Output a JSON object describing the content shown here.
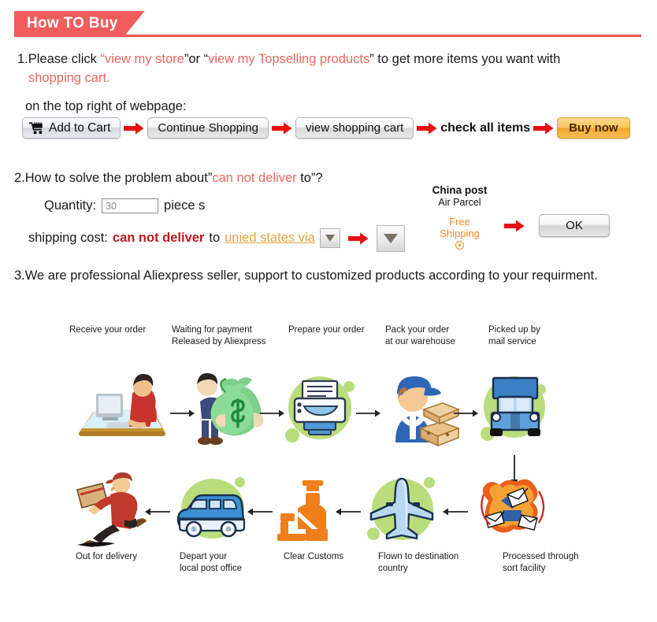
{
  "header": {
    "title": "How TO Buy",
    "accent_color": "#f25c5c"
  },
  "section1": {
    "number": "1.",
    "line1_a": "Please click ",
    "line1_quote_open": "“",
    "link1": "view my store",
    "line1_quote_close": "”",
    "line1_b": "or ",
    "quote2_open": "“",
    "link2": "view my Topselling products",
    "quote2_close": "”",
    "line1_c": " to get more items you want with",
    "line2": "shopping cart.",
    "line3": "on the top right of webpage:"
  },
  "buttons": {
    "add_to_cart": "Add to Cart",
    "cart_icon": "shopping-cart-icon",
    "continue_shopping": "Continue Shopping",
    "view_shopping_cart": "view shopping cart",
    "check_all_items": "check all items",
    "buy_now": "Buy now",
    "buy_now_color": "#f0a82e"
  },
  "section2": {
    "number": "2.",
    "line1_a": "How to solve the problem about”",
    "line1_red": "can not deliver",
    "line1_b": " to”?",
    "quantity_label": "Quantity:",
    "quantity_value": "30",
    "piece_label": "piece s",
    "shipping_label": "shipping cost:",
    "shipping_red": "can not deliver",
    "shipping_to": " to ",
    "shipping_country": "unied states via",
    "dropdown_icon": "chevron-down-icon"
  },
  "china_post": {
    "title": "China post",
    "subtitle": "Air Parcel",
    "free_line1": "Free",
    "free_line2": "Shipping",
    "radio_icon": "radio-selected-icon",
    "free_color": "#f08a22",
    "ok_button": "OK"
  },
  "section3": {
    "text": "3.We are professional Aliexpress seller, support to customized products according to your requirment."
  },
  "flowchart": {
    "top_labels": [
      "Receive your order",
      "Waiting for payment\nReleased by Aliexpress",
      "Prepare your order",
      "Pack your order\nat our warehouse",
      "Picked up by\nmail service"
    ],
    "bottom_labels": [
      "Out for delivery",
      "Depart your\nlocal post office",
      "Clear Customs",
      "Flown to destination\ncountry",
      "Processed through\nsort facility"
    ],
    "top_icons": [
      "person-at-computer-icon",
      "money-bag-carrier-icon",
      "printer-icon",
      "warehouse-worker-boxes-icon",
      "mail-truck-icon"
    ],
    "bottom_icons": [
      "running-delivery-man-icon",
      "delivery-van-icon",
      "customs-officer-icon",
      "airplane-icon",
      "sorting-facility-envelopes-icon"
    ],
    "blob_color": "#b9dd7c"
  }
}
